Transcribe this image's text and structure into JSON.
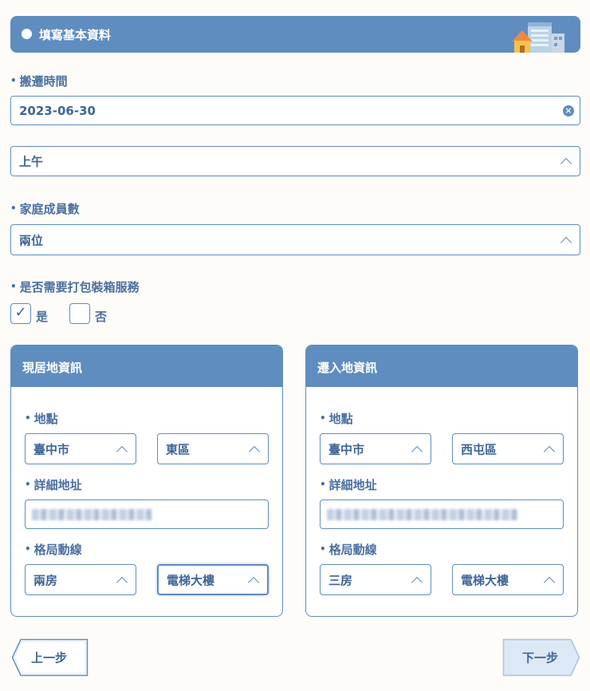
{
  "header": {
    "title": "填寫基本資料"
  },
  "moving_time": {
    "label": "搬遷時間",
    "date_value": "2023-06-30",
    "period_value": "上午"
  },
  "family_members": {
    "label": "家庭成員數",
    "value": "兩位"
  },
  "packing_service": {
    "label": "是否需要打包裝箱服務",
    "yes_label": "是",
    "no_label": "否",
    "check_mark": "✓",
    "selected": "是"
  },
  "current_residence": {
    "title": "現居地資訊",
    "location_label": "地點",
    "city": "臺中市",
    "district": "東區",
    "address_label": "詳細地址",
    "layout_label": "格局動線",
    "rooms": "兩房",
    "building_type": "電梯大樓"
  },
  "new_residence": {
    "title": "遷入地資訊",
    "location_label": "地點",
    "city": "臺中市",
    "district": "西屯區",
    "address_label": "詳細地址",
    "layout_label": "格局動線",
    "rooms": "三房",
    "building_type": "電梯大樓"
  },
  "nav": {
    "prev_label": "上一步",
    "next_label": "下一步"
  },
  "colors": {
    "primary": "#5f8dc0",
    "text": "#4a6fa0",
    "background": "#fdfcf8",
    "disabled_button": "#dce8f5"
  }
}
